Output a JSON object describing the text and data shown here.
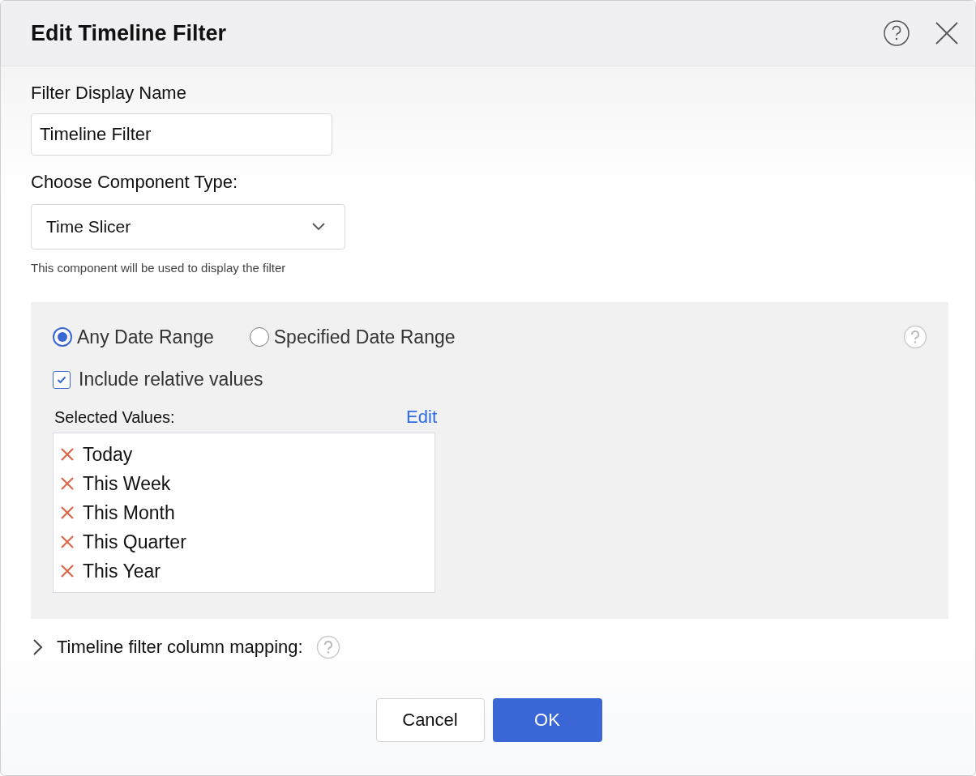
{
  "dialog": {
    "title": "Edit Timeline Filter"
  },
  "display_name": {
    "label": "Filter Display Name",
    "value": "Timeline Filter"
  },
  "component_type": {
    "label": "Choose Component Type:",
    "value": "Time Slicer",
    "hint": "This component will be used to display the filter"
  },
  "date_range": {
    "options": [
      {
        "label": "Any Date Range",
        "selected": true
      },
      {
        "label": "Specified Date Range",
        "selected": false
      }
    ],
    "include_relative": {
      "label": "Include relative values",
      "checked": true
    },
    "selected_values": {
      "label": "Selected Values:",
      "edit": "Edit",
      "items": [
        "Today",
        "This Week",
        "This Month",
        "This Quarter",
        "This Year"
      ]
    }
  },
  "column_mapping": {
    "label": "Timeline filter column mapping:",
    "expanded": false
  },
  "buttons": [
    {
      "label": "Cancel",
      "kind": "secondary"
    },
    {
      "label": "OK",
      "kind": "primary"
    }
  ]
}
